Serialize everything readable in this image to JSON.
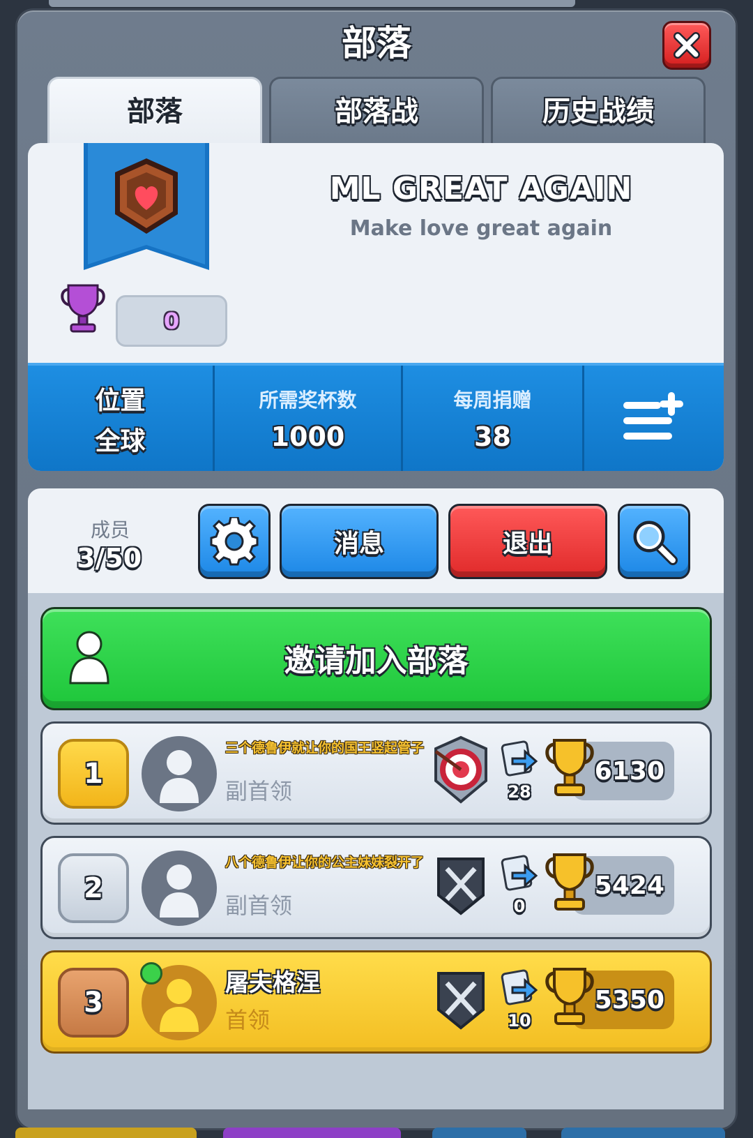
{
  "dialog": {
    "title": "部落"
  },
  "tabs": [
    {
      "label": "部落",
      "active": true
    },
    {
      "label": "部落战",
      "active": false
    },
    {
      "label": "历史战绩",
      "active": false
    }
  ],
  "clan": {
    "name": "ML GREAT AGAIN",
    "description": "Make love great again",
    "war_trophies": "0",
    "badge_icon": "heart-shield-icon"
  },
  "stats": {
    "location_label": "位置",
    "location_value": "全球",
    "required_trophies_label": "所需奖杯数",
    "required_trophies_value": "1000",
    "weekly_donations_label": "每周捐赠",
    "weekly_donations_value": "38",
    "menu_icon": "list-add-icon"
  },
  "members_header": {
    "label": "成员",
    "count": "3/50",
    "settings_icon": "gear-icon",
    "messages_label": "消息",
    "leave_label": "退出",
    "search_icon": "search-icon"
  },
  "invite": {
    "label": "邀请加入部落"
  },
  "members": [
    {
      "rank": "1",
      "name": "三个德鲁伊就让你的国王竖起管子",
      "role": "副首领",
      "donations": "28",
      "trophies": "6130",
      "league_icon": "target-league-icon",
      "online": false,
      "is_self": false
    },
    {
      "rank": "2",
      "name": "八个德鲁伊让你的公主妹妹裂开了",
      "role": "副首领",
      "donations": "0",
      "trophies": "5424",
      "league_icon": "crossed-swords-icon",
      "online": false,
      "is_self": false
    },
    {
      "rank": "3",
      "name": "屠夫格涅",
      "role": "首领",
      "donations": "10",
      "trophies": "5350",
      "league_icon": "crossed-swords-icon",
      "online": true,
      "is_self": true
    }
  ],
  "colors": {
    "accent_blue": "#1c87e6",
    "invite_green": "#1ec63a",
    "leave_red": "#e02a2a",
    "self_row_gold": "#f3be22"
  }
}
